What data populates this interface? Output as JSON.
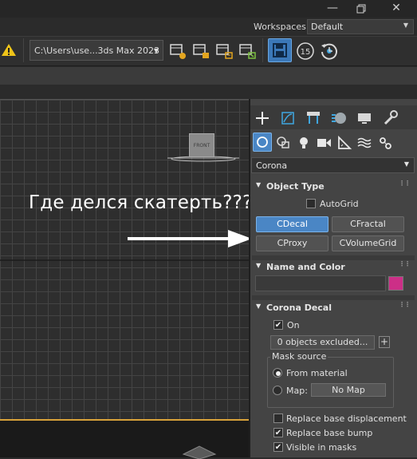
{
  "window": {
    "buttons": [
      "minimize-icon",
      "restore-icon",
      "close-icon"
    ]
  },
  "workspaces": {
    "label": "Workspaces:",
    "value": "Default"
  },
  "toolbar": {
    "path": "C:\\Users\\use...3ds Max 2023",
    "icons": [
      "warning-icon",
      "project-folder-icon",
      "set-project-icon",
      "project-options-icon",
      "archive-project-icon",
      "save-icon",
      "autosave-15-icon",
      "history-icon"
    ],
    "autosave_number": "15"
  },
  "viewport": {
    "overlay_text": "Где делся скатерть???",
    "viewcube_label": "FRONT"
  },
  "panel": {
    "tabs": [
      "create-plus-icon",
      "modify-icon",
      "hierarchy-icon",
      "motion-icon",
      "display-icon",
      "utilities-icon"
    ],
    "subtabs": [
      "geometry-icon",
      "shapes-icon",
      "lights-icon",
      "cameras-icon",
      "helpers-icon",
      "spacewarps-icon",
      "systems-icon"
    ],
    "category": "Corona",
    "object_type": {
      "title": "Object Type",
      "autogrid": "AutoGrid",
      "buttons": [
        "CDecal",
        "CFractal",
        "CProxy",
        "CVolumeGrid"
      ],
      "active": "CDecal"
    },
    "name_color": {
      "title": "Name and Color",
      "swatch_color": "#cc2f87"
    },
    "corona_decal": {
      "title": "Corona Decal",
      "on_label": "On",
      "excluded": "0 objects excluded...",
      "plus": "+",
      "mask_source": "Mask source",
      "from_material": "From material",
      "map_label": "Map:",
      "no_map": "No Map",
      "replace_displacement": "Replace base displacement",
      "replace_bump": "Replace base bump",
      "visible_masks": "Visible in masks"
    }
  },
  "colors": {
    "accent": "#4a86c5",
    "active_border": "#7bb3e9",
    "swatch": "#cc2f87"
  }
}
